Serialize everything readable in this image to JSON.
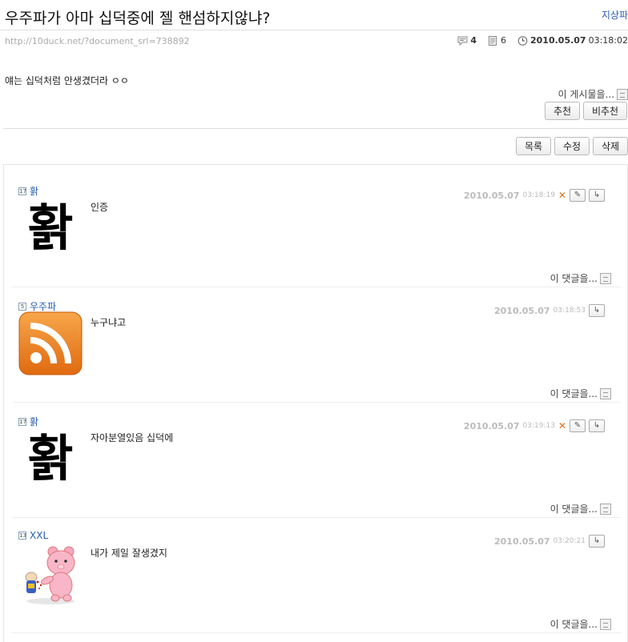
{
  "post": {
    "title": "우주파가 아마 십덕중에 젤 핸섬하지않냐?",
    "author": "지상파",
    "url": "http://10duck.net/?document_srl=738892",
    "comment_count": "4",
    "view_count": "6",
    "date": "2010.05.07",
    "time": "03:18:02",
    "body": "얘는 십덕처럼 안생겼더라 ㅇㅇ",
    "this_post_label": "이 게시물을...",
    "recommend_label": "추천",
    "not_recommend_label": "비추천"
  },
  "actions": {
    "list_label": "목록",
    "edit_label": "수정",
    "delete_label": "삭제"
  },
  "comments": [
    {
      "level": "17",
      "author": "홝",
      "date": "2010.05.07",
      "time": "03:18:19",
      "text": "인증",
      "avatar_glyph": "홝",
      "footer": "이 댓글을..."
    },
    {
      "level": "5",
      "author": "우주파",
      "date": "2010.05.07",
      "time": "03:18:53",
      "text": "누구냐고",
      "avatar_icon": "rss-icon",
      "footer": "이 댓글을..."
    },
    {
      "level": "17",
      "author": "홝",
      "date": "2010.05.07",
      "time": "03:19:13",
      "text": "자아분열있음 십덕에",
      "avatar_glyph": "홝",
      "footer": "이 댓글을..."
    },
    {
      "level": "13",
      "author": "XXL",
      "date": "2010.05.07",
      "time": "03:20:21",
      "text": "내가 제일 잘생겼지",
      "avatar_icon": "pink-bear-icon",
      "footer": "이 댓글을..."
    }
  ],
  "colors": {
    "link": "#2a5db0",
    "rss_orange": "#f28b22",
    "delete_mark": "#e07020"
  }
}
